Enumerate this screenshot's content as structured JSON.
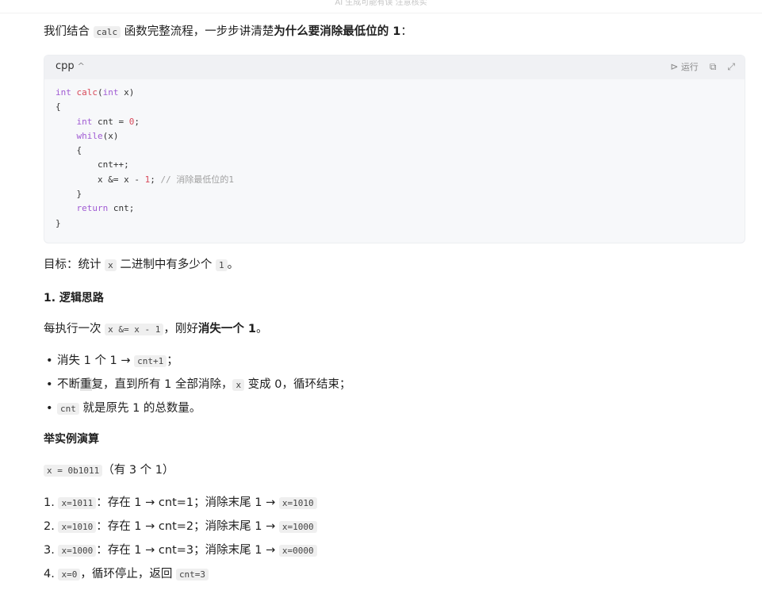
{
  "top_note": "AI 生成可能有误 注意核实",
  "intro": {
    "prefix": "我们结合 ",
    "code": "calc",
    "middle": " 函数完整流程，一步步讲清楚",
    "bold": "为什么要消除最低位的 1",
    "suffix": "："
  },
  "codeblock": {
    "language": "cpp",
    "run_label": "运行",
    "lines": {
      "l1_kw": "int",
      "l1_fn": "calc",
      "l1_a": "(",
      "l1_kw2": "int",
      "l1_b": " x)",
      "l2": "{",
      "l3_kw": "int",
      "l3_a": " cnt = ",
      "l3_num": "0",
      "l3_b": ";",
      "l4_kw": "while",
      "l4_a": "(x)",
      "l5": "{",
      "l6": "cnt++;",
      "l7_a": "x &= x - ",
      "l7_num": "1",
      "l7_b": "; ",
      "l7_cm": "// 消除最低位的1",
      "l8": "}",
      "l9_kw": "return",
      "l9_a": " cnt;",
      "l10": "}"
    }
  },
  "goal": {
    "prefix": "目标：统计 ",
    "code1": "x",
    "middle": " 二进制中有多少个 ",
    "code2": "1",
    "suffix": "。"
  },
  "section1_title": "1. 逻辑思路",
  "logic": {
    "prefix": "每执行一次 ",
    "code": "x &= x - 1",
    "middle": "，刚好",
    "bold": "消失一个 1",
    "suffix": "。"
  },
  "bullets": {
    "b1_text": "消失 1 个 1 → ",
    "b1_code": "cnt+1",
    "b1_suffix": "；",
    "b2_a": "不断",
    "b2_hl": "重",
    "b2_b": "复，直到所有 1 全部消除，",
    "b2_code": "x",
    "b2_c": " 变成 0，循环结束；",
    "b3_code": "cnt",
    "b3_text": " 就是原先 1 的总数量。"
  },
  "section2_title": "举实例演算",
  "example": {
    "code": "x = 0b1011",
    "suffix": "（有 3 个 1）"
  },
  "steps": {
    "s1_num": "1. ",
    "s1_code": "x=1011",
    "s1_text": "：存在 1 → cnt=1；消除末尾 1 → ",
    "s1_code2": "x=1010",
    "s2_num": "2. ",
    "s2_code": "x=1010",
    "s2_text": "：存在 1 → cnt=2；消除末尾 1 → ",
    "s2_code2": "x=1000",
    "s3_num": "3. ",
    "s3_code": "x=1000",
    "s3_text": "：存在 1 → cnt=3；消除末尾 1 → ",
    "s3_code2": "x=0000",
    "s4_num": "4. ",
    "s4_code": "x=0",
    "s4_text": "，循环停止，返回 ",
    "s4_code2": "cnt=3"
  }
}
